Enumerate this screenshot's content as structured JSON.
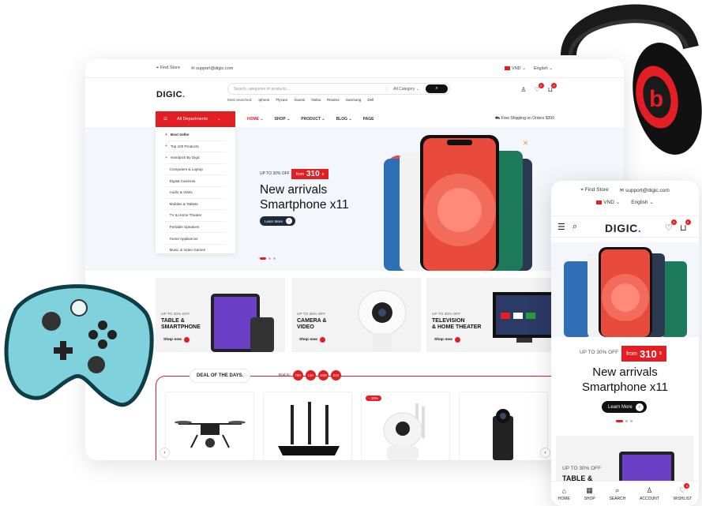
{
  "desktop": {
    "topbar": {
      "find_store": "Find Store",
      "email": "support@digic.com",
      "currency": "VND",
      "language": "English"
    },
    "header": {
      "logo": "DIGIC",
      "logo_dot": ".",
      "search_placeholder": "Search categories or products...",
      "category": "All Category",
      "most_searched_label": "Most searched:",
      "most_searched": [
        "Iphone",
        "Flycam",
        "Xiaomi",
        "Nokia",
        "Realme",
        "Samsung",
        "Dell"
      ],
      "wishlist_count": "0",
      "cart_count": "0"
    },
    "nav": {
      "departments": "All Departments",
      "menu": [
        "HOME",
        "SHOP",
        "PRODUCT",
        "BLOG",
        "PAGE"
      ],
      "shipping": "Free Shipping on Orders $300"
    },
    "departments": [
      {
        "label": "Best Seller",
        "mark": "+"
      },
      {
        "label": "Top 100 Products",
        "mark": "+"
      },
      {
        "label": "Handpick By Digic",
        "mark": "+"
      },
      {
        "label": "Computers & Laptop",
        "mark": "·"
      },
      {
        "label": "Digital Cameras",
        "mark": "·"
      },
      {
        "label": "Audio & Video",
        "mark": "·"
      },
      {
        "label": "Mobiles & Tablets",
        "mark": "·"
      },
      {
        "label": "TV & Home Theater",
        "mark": "·"
      },
      {
        "label": "Portable Speakers",
        "mark": "·"
      },
      {
        "label": "Home Appliances",
        "mark": "·"
      },
      {
        "label": "Music & Video Games",
        "mark": "·"
      }
    ],
    "hero": {
      "upto": "UP TO 30% OFF",
      "from": "from",
      "price": "310",
      "currency": "$",
      "title1": "New arrivals",
      "title2": "Smartphone x11",
      "button": "Learn More"
    },
    "promos": [
      {
        "upto": "UP TO 30% OFF",
        "line1": "TABLE &",
        "line2": "SMARTPHONE",
        "button": "Shop now"
      },
      {
        "upto": "UP TO 30% OFF",
        "line1": "CAMERA &",
        "line2": "VIDEO",
        "button": "Shop now"
      },
      {
        "upto": "UP TO 30% OFF",
        "line1": "TELEVISION",
        "line2": "& HOME THEATER",
        "button": "Shop now"
      }
    ],
    "deal": {
      "title": "DEAL OF THE DAYS.",
      "end_in": "End in:",
      "timer": [
        "79D",
        "12H",
        "40M",
        "31S"
      ],
      "sale_badge": "- 10%"
    }
  },
  "mobile": {
    "find_store": "Find Store",
    "email": "support@digic.com",
    "currency": "VND",
    "language": "English",
    "logo": "DIGIC",
    "logo_dot": ".",
    "wishlist_count": "0",
    "cart_count": "0",
    "hero": {
      "upto": "UP TO 30% OFF",
      "from": "from",
      "price": "310",
      "currency": "$",
      "title1": "New arrivals",
      "title2": "Smartphone x11",
      "button": "Learn More"
    },
    "promo": {
      "upto": "UP TO 30% OFF",
      "line1": "TABLE &"
    },
    "bottom_bar": [
      {
        "label": "HOME",
        "icon": "home-icon"
      },
      {
        "label": "SHOP",
        "icon": "shop-icon"
      },
      {
        "label": "SEARCH",
        "icon": "search-icon"
      },
      {
        "label": "ACCOUNT",
        "icon": "user-icon"
      },
      {
        "label": "WISHLIST",
        "icon": "heart-icon"
      }
    ],
    "bottom_wishlist_count": "0"
  },
  "colors": {
    "accent": "#e31e24",
    "dark": "#111111",
    "hero_bg": "#f3f6fa",
    "controller": "#7fd1dc"
  }
}
